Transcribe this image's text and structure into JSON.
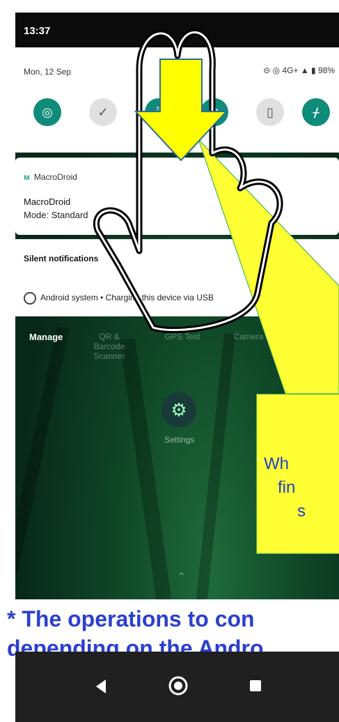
{
  "status_bar": {
    "time": "13:37"
  },
  "quick_settings": {
    "date": "Mon, 12 Sep",
    "status_text": "⊝ ◎ 4G+ ▲ ▮ 98%"
  },
  "macrodroid_card": {
    "app_name": "MacroDroid",
    "title": "MacroDroid",
    "mode": "Mode: Standard"
  },
  "silent_card": {
    "header": "Silent notifications",
    "row": "Android system • Charging this device via USB"
  },
  "home": {
    "manage": "Manage",
    "apps": [
      "QR & Barcode Scanner",
      "GPS Test",
      "Camera"
    ],
    "settings_label": "Settings"
  },
  "callout_text": [
    "Wh",
    "fin",
    "s"
  ],
  "note_lines": [
    "* The operations to con",
    "depending on the Andro"
  ],
  "colors": {
    "accent_teal": "#0f8b7a",
    "callout_yellow": "#ffff33",
    "note_blue": "#2b3fcf"
  }
}
